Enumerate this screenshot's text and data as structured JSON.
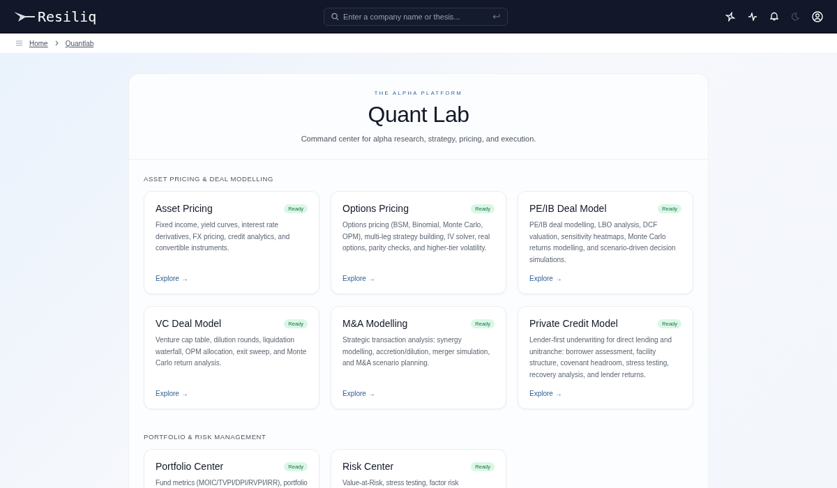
{
  "topbar": {
    "logo": "Resiliq",
    "search": {
      "placeholder": "Enter a company name or thesis..."
    }
  },
  "breadcrumb": [
    "Home",
    "Quantlab"
  ],
  "header": {
    "eyebrow": "THE ALPHA PLATFORM",
    "title": "Quant Lab",
    "subtitle": "Command center for alpha research, strategy, pricing, and execution."
  },
  "sections": [
    {
      "title": "ASSET PRICING & DEAL MODELLING",
      "cards": [
        {
          "title": "Asset Pricing",
          "status": "Ready",
          "description": "Fixed income, yield curves, interest rate derivatives, FX pricing, credit analytics, and convertible instruments.",
          "link": "Explore →"
        },
        {
          "title": "Options Pricing",
          "status": "Ready",
          "description": "Options pricing (BSM, Binomial, Monte Carlo, OPM), multi-leg strategy building, IV solver, real options, parity checks, and higher-tier volatility.",
          "link": "Explore →"
        },
        {
          "title": "PE/IB Deal Model",
          "status": "Ready",
          "description": "PE/IB deal modelling, LBO analysis, DCF valuation, sensitivity heatmaps, Monte Carlo returns modelling, and scenario-driven decision simulations.",
          "link": "Explore →"
        },
        {
          "title": "VC Deal Model",
          "status": "Ready",
          "description": "Venture cap table, dilution rounds, liquidation waterfall, OPM allocation, exit sweep, and Monte Carlo return analysis.",
          "link": "Explore →"
        },
        {
          "title": "M&A Modelling",
          "status": "Ready",
          "description": "Strategic transaction analysis: synergy modelling, accretion/dilution, merger simulation, and M&A scenario planning.",
          "link": "Explore →"
        },
        {
          "title": "Private Credit Model",
          "status": "Ready",
          "description": "Lender-first underwriting for direct lending and unitranche: borrower assessment, facility structure, covenant headroom, stress testing, recovery analysis, and lender returns.",
          "link": "Explore →"
        }
      ]
    },
    {
      "title": "PORTFOLIO & RISK MANAGEMENT",
      "cards": [
        {
          "title": "Portfolio Center",
          "status": "Ready",
          "description": "Fund metrics (MOIC/TVPI/DPI/RVPI/IRR), portfolio"
        },
        {
          "title": "Risk Center",
          "status": "Ready",
          "description": "Value-at-Risk, stress testing, factor risk"
        }
      ]
    }
  ]
}
